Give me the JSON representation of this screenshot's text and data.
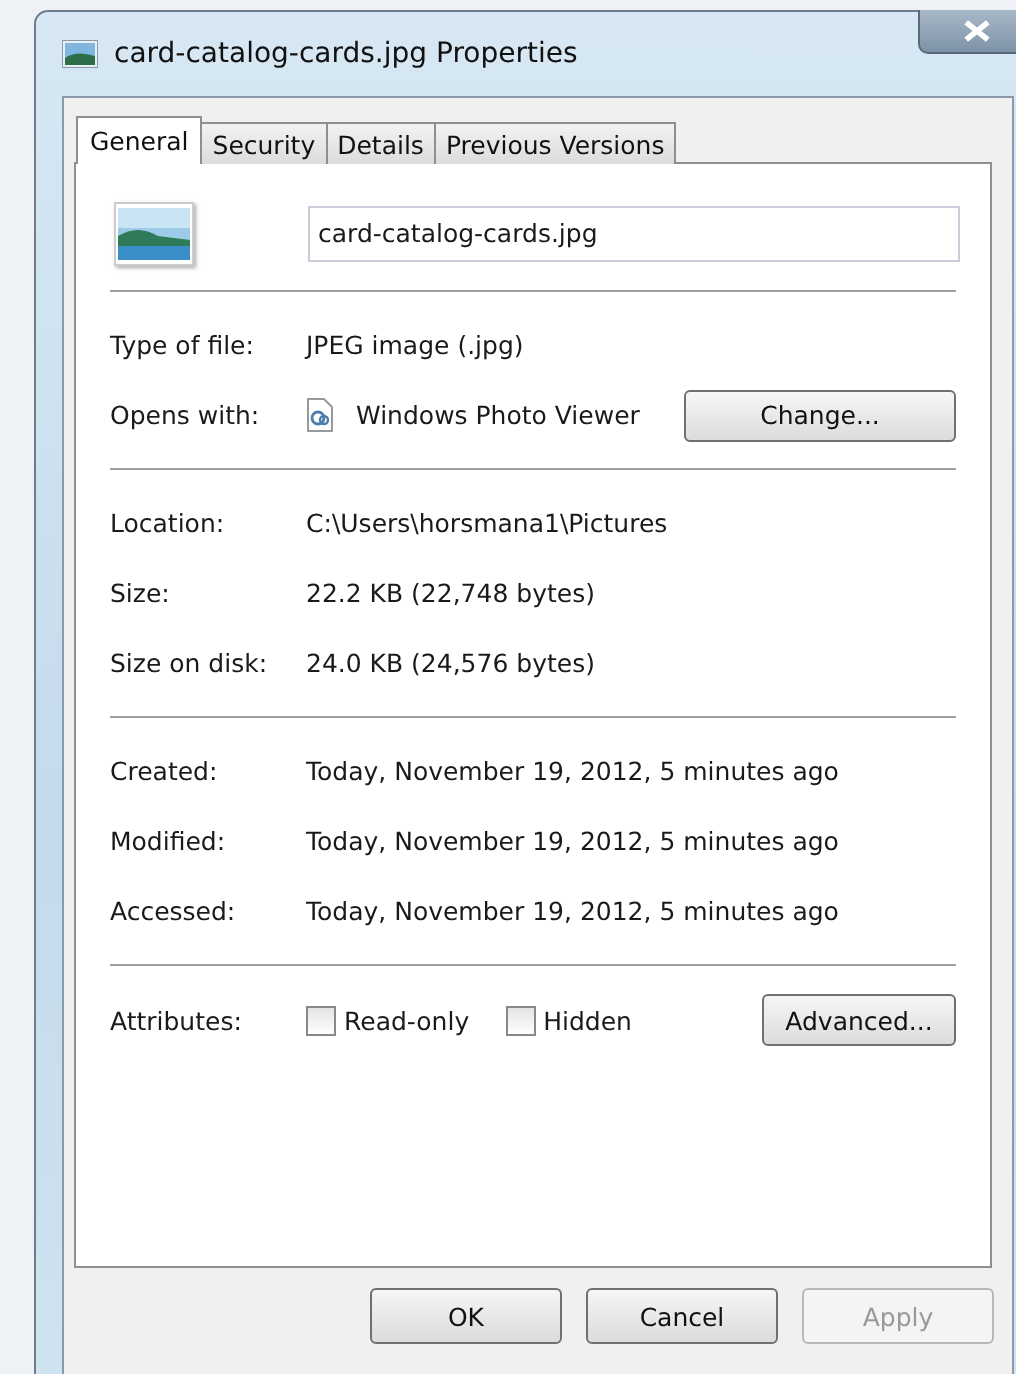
{
  "window": {
    "title": "card-catalog-cards.jpg Properties"
  },
  "tabs": [
    {
      "label": "General",
      "selected": true
    },
    {
      "label": "Security",
      "selected": false
    },
    {
      "label": "Details",
      "selected": false
    },
    {
      "label": "Previous Versions",
      "selected": false
    }
  ],
  "file_name": "card-catalog-cards.jpg",
  "sections": [
    [
      {
        "label": "Type of file:",
        "value": "JPEG image (.jpg)"
      },
      {
        "label": "Opens with:",
        "value": "Windows Photo Viewer",
        "button": "Change..."
      }
    ],
    [
      {
        "label": "Location:",
        "value": "C:\\Users\\horsmana1\\Pictures"
      },
      {
        "label": "Size:",
        "value": "22.2 KB (22,748 bytes)"
      },
      {
        "label": "Size on disk:",
        "value": "24.0 KB (24,576 bytes)"
      }
    ],
    [
      {
        "label": "Created:",
        "value": "Today, November 19, 2012, 5 minutes ago"
      },
      {
        "label": "Modified:",
        "value": "Today, November 19, 2012, 5 minutes ago"
      },
      {
        "label": "Accessed:",
        "value": "Today, November 19, 2012, 5 minutes ago"
      }
    ]
  ],
  "attributes": {
    "label": "Attributes:",
    "options": [
      {
        "label": "Read-only",
        "checked": false
      },
      {
        "label": "Hidden",
        "checked": false
      }
    ],
    "button": "Advanced..."
  },
  "buttons": [
    {
      "label": "OK",
      "disabled": false
    },
    {
      "label": "Cancel",
      "disabled": false
    },
    {
      "label": "Apply",
      "disabled": true
    }
  ]
}
